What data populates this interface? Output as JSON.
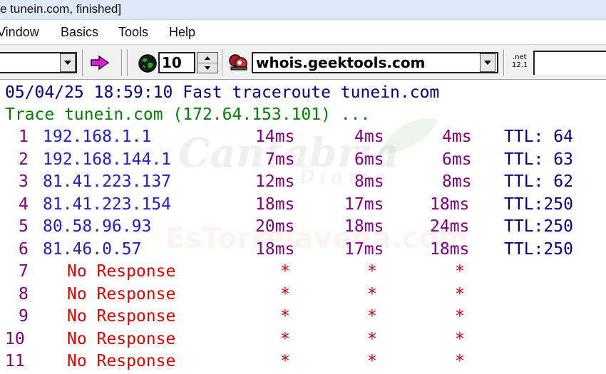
{
  "window": {
    "title": "e tunein.com, finished]"
  },
  "menubar": {
    "items": [
      "Window",
      "Basics",
      "Tools",
      "Help"
    ],
    "first_item_visible": "Vindow"
  },
  "toolbar": {
    "hop_count": "10",
    "whois_server": "whois.geektools.com",
    "net_badge_top": ".net",
    "net_badge_bottom": "12.1",
    "icons": [
      "dropdown-arrow-icon",
      "go-arrow-icon",
      "globe-icon",
      "spinner-icon",
      "whois-icon",
      "net-version-icon"
    ]
  },
  "output": {
    "header_line": "05/04/25 18:59:10 Fast traceroute tunein.com",
    "trace_line": "Trace tunein.com (172.64.153.101) ...",
    "hops": [
      {
        "num": "1",
        "host": "192.168.1.1",
        "t1": "14ms",
        "t2": "4ms",
        "t3": "4ms",
        "ttl": "TTL: 64"
      },
      {
        "num": "2",
        "host": "192.168.144.1",
        "t1": "7ms",
        "t2": "6ms",
        "t3": "6ms",
        "ttl": "TTL: 63"
      },
      {
        "num": "3",
        "host": "81.41.223.137",
        "t1": "12ms",
        "t2": "8ms",
        "t3": "8ms",
        "ttl": "TTL: 62"
      },
      {
        "num": "4",
        "host": "81.41.223.154",
        "t1": "18ms",
        "t2": "17ms",
        "t3": "18ms",
        "ttl": "TTL:250"
      },
      {
        "num": "5",
        "host": "80.58.96.93",
        "t1": "20ms",
        "t2": "18ms",
        "t3": "24ms",
        "ttl": "TTL:250"
      },
      {
        "num": "6",
        "host": "81.46.0.57",
        "t1": "18ms",
        "t2": "17ms",
        "t3": "18ms",
        "ttl": "TTL:250"
      }
    ],
    "no_response": [
      {
        "num": "7",
        "label": "No Response",
        "s1": "*",
        "s2": "*",
        "s3": "*"
      },
      {
        "num": "8",
        "label": "No Response",
        "s1": "*",
        "s2": "*",
        "s3": "*"
      },
      {
        "num": "9",
        "label": "No Response",
        "s1": "*",
        "s2": "*",
        "s3": "*"
      },
      {
        "num": "10",
        "label": "No Response",
        "s1": "*",
        "s2": "*",
        "s3": "*"
      },
      {
        "num": "11",
        "label": "No Response",
        "s1": "*",
        "s2": "*",
        "s3": "*"
      }
    ]
  },
  "watermark": {
    "main": "Cantabria",
    "sub": "Diario",
    "site": "EsTorrelavega.com"
  },
  "colors": {
    "header": "#000080",
    "trace": "#008000",
    "hop_number": "#800080",
    "host": "#2020c8",
    "timing": "#800080",
    "ttl": "#000080",
    "no_response": "#e00000"
  }
}
